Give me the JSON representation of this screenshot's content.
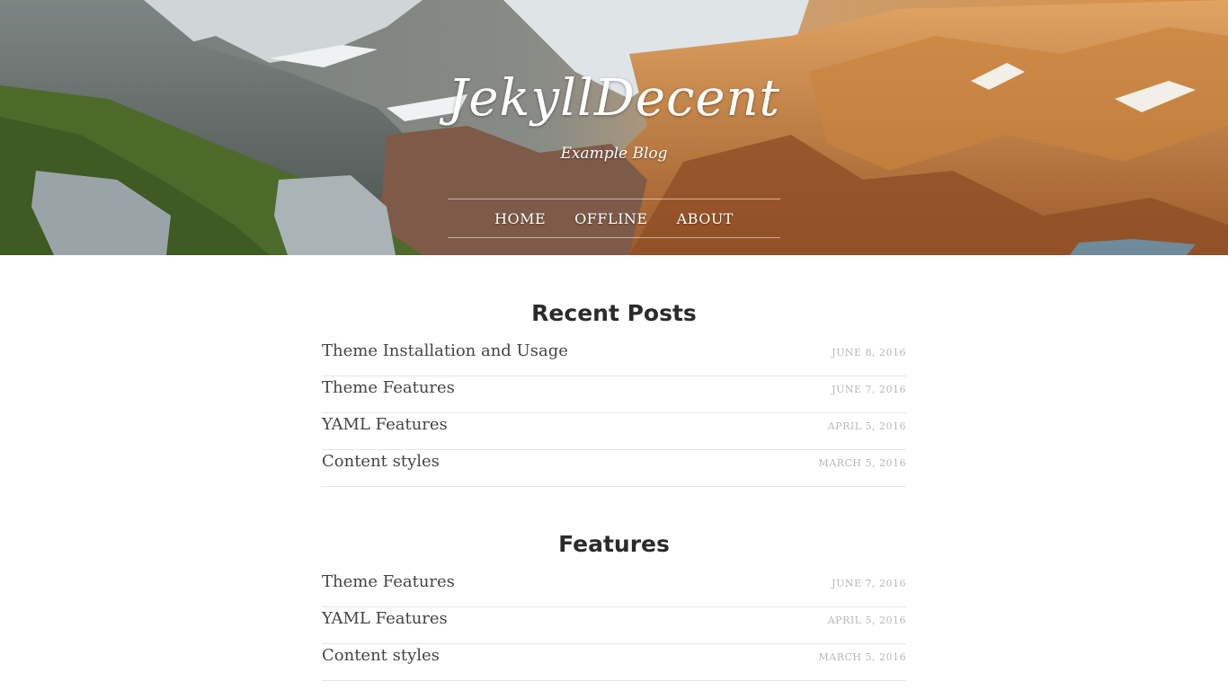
{
  "header": {
    "site_title": "JekyllDecent",
    "subtitle": "Example Blog",
    "nav": [
      {
        "label": "HOME"
      },
      {
        "label": "OFFLINE"
      },
      {
        "label": "ABOUT"
      }
    ],
    "background": "mountain-landscape-image"
  },
  "sections": [
    {
      "title": "Recent Posts",
      "posts": [
        {
          "title": "Theme Installation and Usage",
          "date": "JUNE 8, 2016"
        },
        {
          "title": "Theme Features",
          "date": "JUNE 7, 2016"
        },
        {
          "title": "YAML Features",
          "date": "APRIL 5, 2016"
        },
        {
          "title": "Content styles",
          "date": "MARCH 5, 2016"
        }
      ]
    },
    {
      "title": "Features",
      "posts": [
        {
          "title": "Theme Features",
          "date": "JUNE 7, 2016"
        },
        {
          "title": "YAML Features",
          "date": "APRIL 5, 2016"
        },
        {
          "title": "Content styles",
          "date": "MARCH 5, 2016"
        }
      ]
    }
  ],
  "colors": {
    "heading": "#2b2b2b",
    "post_title": "#444444",
    "date": "#b8b8b8",
    "divider": "#e6e6e6"
  }
}
